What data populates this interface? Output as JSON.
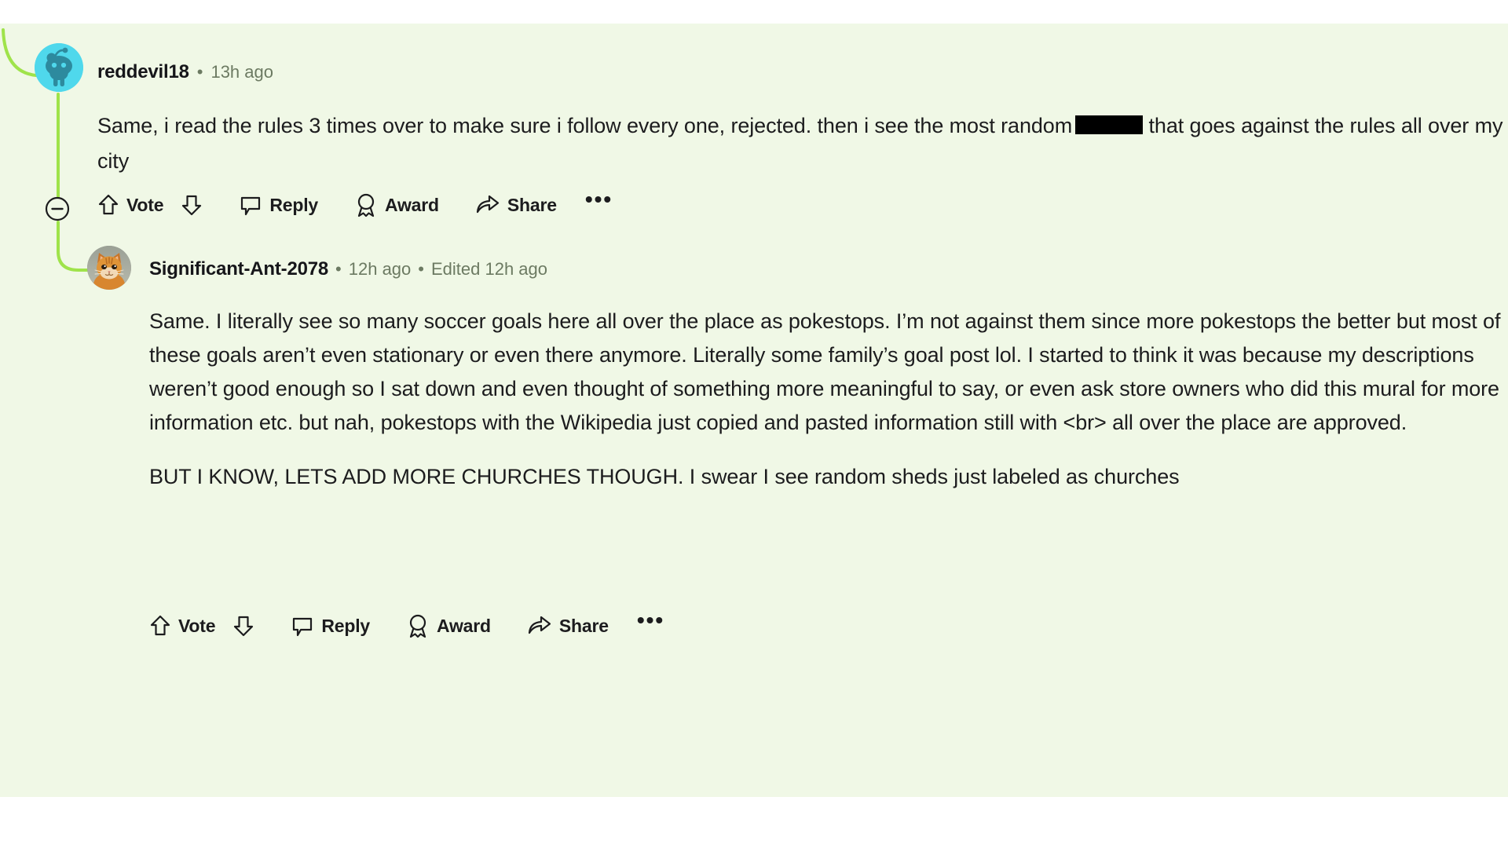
{
  "theme": {
    "panel_bg": "#f0f8e6",
    "page_bg": "#ffffff",
    "thread_line": "#9fe34a",
    "text": "#1c1c1e",
    "meta_text": "#6c7a62",
    "avatar_bg": "#4fd8ec",
    "redaction": "#000000"
  },
  "comments": [
    {
      "id": "comment-reddevil18",
      "username": "reddevil18",
      "separator": "•",
      "timestamp": "13h ago",
      "avatar_type": "reddit-snoo-avatar",
      "body_before_redaction": "Same, i read the rules 3 times over to make sure i follow every one, rejected. then i see the most random",
      "redacted": true,
      "body_after_redaction": "that goes against the rules all over my city",
      "collapse_icon": "collapse-minus-icon",
      "actions": {
        "upvote_icon": "upvote-arrow-icon",
        "vote_label": "Vote",
        "downvote_icon": "downvote-arrow-icon",
        "reply_icon": "comment-bubble-icon",
        "reply_label": "Reply",
        "award_icon": "award-medal-icon",
        "award_label": "Award",
        "share_icon": "share-arrow-icon",
        "share_label": "Share",
        "more_label": "•••"
      }
    },
    {
      "id": "comment-significant-ant-2078",
      "username": "Significant-Ant-2078",
      "separator": "•",
      "timestamp": "12h ago",
      "separator2": "•",
      "edited": "Edited 12h ago",
      "avatar_type": "cat-photo-avatar",
      "paragraphs": [
        "Same. I literally see so many soccer goals here all over the place as pokestops. I’m not against them since more pokestops the better but most of these goals aren’t even stationary or even there anymore. Literally some family’s goal post lol. I started to think it was because my descriptions weren’t good enough so I sat down and even thought of something more meaningful to say, or even ask store owners who did this mural for more information etc. but nah, pokestops with the Wikipedia just copied and pasted information still with <br> all over the place are approved.",
        "BUT I KNOW, LETS ADD MORE CHURCHES THOUGH. I swear I see random sheds just labeled as churches"
      ],
      "actions": {
        "upvote_icon": "upvote-arrow-icon",
        "vote_label": "Vote",
        "downvote_icon": "downvote-arrow-icon",
        "reply_icon": "comment-bubble-icon",
        "reply_label": "Reply",
        "award_icon": "award-medal-icon",
        "award_label": "Award",
        "share_icon": "share-arrow-icon",
        "share_label": "Share",
        "more_label": "•••"
      }
    }
  ]
}
